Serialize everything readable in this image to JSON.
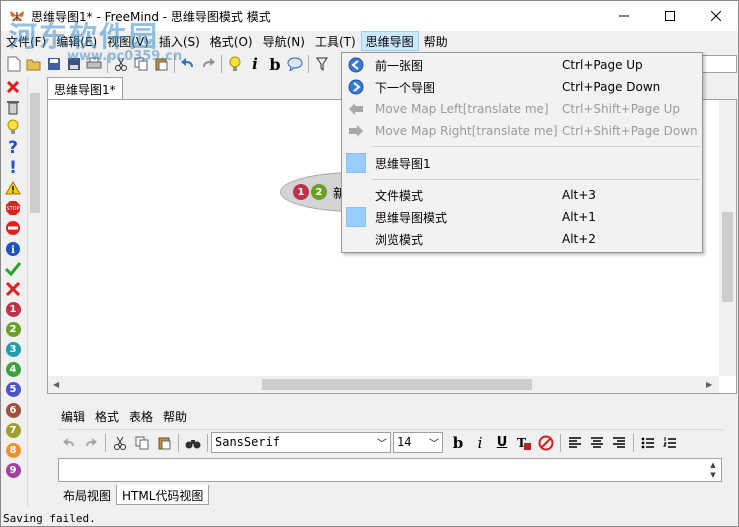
{
  "window": {
    "title": "思维导图1* - FreeMind - 思维导图模式 模式",
    "controls": {
      "minimize": "─",
      "maximize": "☐",
      "close": "✕"
    }
  },
  "menubar": [
    {
      "label": "文件(F)"
    },
    {
      "label": "编辑(E)"
    },
    {
      "label": "视图(V)"
    },
    {
      "label": "插入(S)"
    },
    {
      "label": "格式(O)"
    },
    {
      "label": "导航(N)"
    },
    {
      "label": "工具(T)"
    },
    {
      "label": "思维导图",
      "active": true
    },
    {
      "label": "帮助"
    }
  ],
  "toolbar": {
    "icons": [
      "new-file-icon",
      "open-file-icon",
      "save-icon",
      "save-as-icon",
      "print-icon",
      "cut-icon",
      "copy-icon",
      "paste-icon",
      "undo-icon",
      "redo-icon",
      "lightbulb-icon",
      "italic-icon",
      "bold-icon",
      "speech-bubble-icon",
      "filter-icon"
    ],
    "italic_glyph": "i",
    "bold_glyph": "b"
  },
  "palette": {
    "icons": [
      "delete-x-icon",
      "trash-icon",
      "idea-icon",
      "question-icon",
      "exclamation-icon",
      "warning-icon",
      "stop-icon",
      "no-entry-icon",
      "info-icon",
      "check-icon",
      "cross-icon",
      "priority-1-icon",
      "priority-2-icon",
      "priority-3-icon",
      "priority-4-icon",
      "priority-5-icon",
      "priority-6-icon",
      "priority-7-icon",
      "priority-8-icon",
      "priority-9-icon"
    ],
    "numbers": [
      "1",
      "2",
      "3",
      "4",
      "5",
      "6",
      "7",
      "8",
      "9"
    ],
    "colors": {
      "red": "#e02020",
      "blue": "#1e63c8",
      "green": "#2aa02a",
      "yellow": "#f0c000",
      "num": [
        "#c0304a",
        "#6a9f28",
        "#1f9dab",
        "#40a040",
        "#5050c8",
        "#a05040",
        "#a0a030",
        "#f09030",
        "#a040a0"
      ]
    }
  },
  "tab": {
    "label": "思维导图1*"
  },
  "map": {
    "node_text": "新",
    "node_priorities": [
      "1",
      "2"
    ]
  },
  "dropdown": {
    "items": [
      {
        "label": "前一张图",
        "shortcut": "Ctrl+Page Up",
        "icon": "back-circle-icon",
        "disabled": false
      },
      {
        "label": "下一个导图",
        "shortcut": "Ctrl+Page Down",
        "icon": "forward-circle-icon",
        "disabled": false
      },
      {
        "label": "Move Map Left[translate me]",
        "shortcut": "Ctrl+Shift+Page Up",
        "icon": "arrow-left-icon",
        "disabled": true
      },
      {
        "label": "Move Map Right[translate me]",
        "shortcut": "Ctrl+Shift+Page Down",
        "icon": "arrow-right-icon",
        "disabled": true
      },
      {
        "label": "思维导图1",
        "shortcut": "",
        "icon": "selected-square",
        "disabled": false
      },
      {
        "label": "文件模式",
        "shortcut": "Alt+3",
        "icon": "",
        "disabled": false
      },
      {
        "label": "思维导图模式",
        "shortcut": "Alt+1",
        "icon": "selected-square",
        "disabled": false
      },
      {
        "label": "浏览模式",
        "shortcut": "Alt+2",
        "icon": "",
        "disabled": false
      }
    ]
  },
  "note_editor": {
    "menu": [
      "编辑",
      "格式",
      "表格",
      "帮助"
    ],
    "font_family": "SansSerif",
    "font_size": "14",
    "bold": "b",
    "italic": "i",
    "underline": "U",
    "tabs": [
      {
        "label": "布局视图",
        "active": false
      },
      {
        "label": "HTML代码视图",
        "active": true
      }
    ]
  },
  "status": {
    "text": "Saving failed."
  },
  "watermark": {
    "main": "河东软件园",
    "url": "www.pc0359.cn"
  }
}
